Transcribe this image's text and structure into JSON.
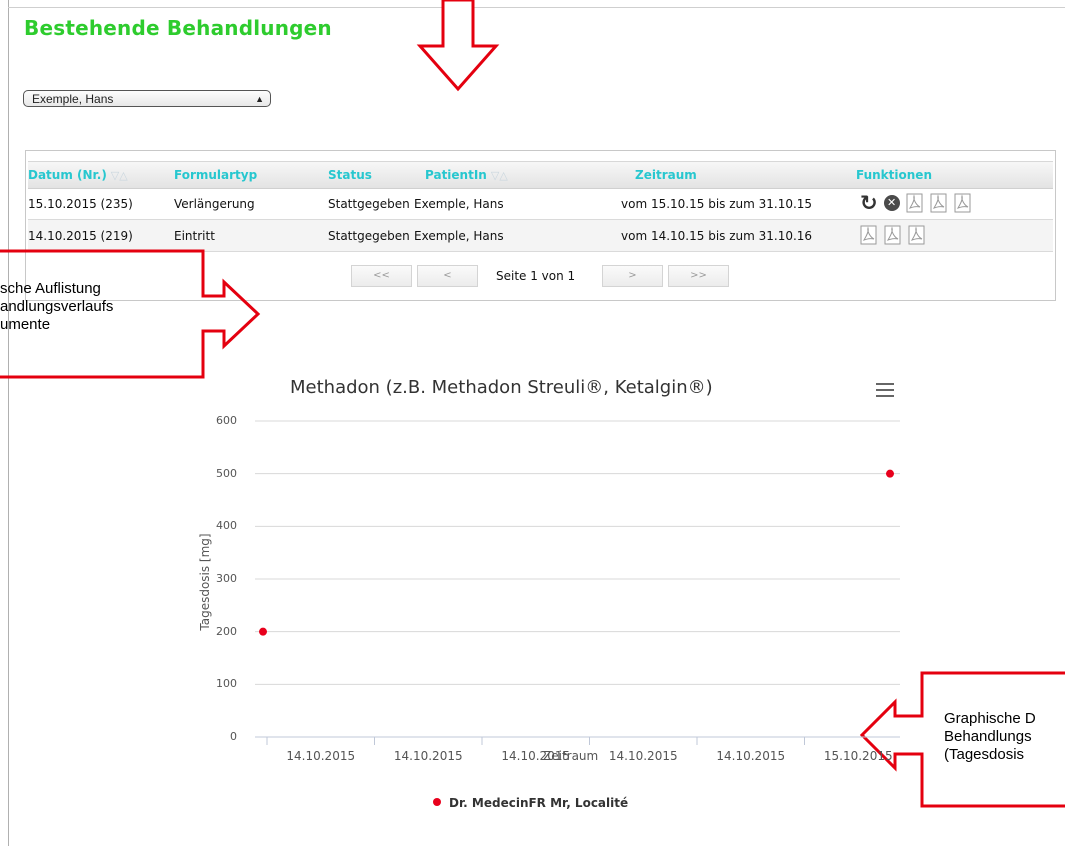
{
  "page_title": "Bestehende Behandlungen",
  "patient_select": {
    "value": "Exemple, Hans"
  },
  "table": {
    "headers": {
      "datum": "Datum (Nr.)",
      "formulartyp": "Formulartyp",
      "status": "Status",
      "patient": "PatientIn",
      "zeitraum": "Zeitraum",
      "funktionen": "Funktionen"
    },
    "sort_glyph": "▽△",
    "rows": [
      {
        "datum": "15.10.2015 (235)",
        "formulartyp": "Verlängerung",
        "status": "Stattgegeben",
        "patient": "Exemple, Hans",
        "zeitraum": "vom 15.10.15 bis zum 31.10.15"
      },
      {
        "datum": "14.10.2015 (219)",
        "formulartyp": "Eintritt",
        "status": "Stattgegeben",
        "patient": "Exemple, Hans",
        "zeitraum": "vom 14.10.15 bis zum 31.10.16"
      }
    ]
  },
  "pager": {
    "first": "<<",
    "prev": "<",
    "info": "Seite 1 von 1",
    "next": ">",
    "last": ">>"
  },
  "annotations": {
    "left_line1": "sche Auflistung",
    "left_line2": "andlungsverlaufs",
    "left_line3": "umente",
    "right_line1": "Graphische D",
    "right_line2": "Behandlungs",
    "right_line3": "(Tagesdosis"
  },
  "chart_data": {
    "type": "scatter",
    "title": "Methadon (z.B. Methadon Streuli®, Ketalgin®)",
    "xlabel": "Zeitraum",
    "ylabel": "Tagesdosis [mg]",
    "ylim": [
      0,
      600
    ],
    "y_ticks": [
      "0",
      "100",
      "200",
      "300",
      "400",
      "500",
      "600"
    ],
    "x_tick_labels": [
      "14.10.2015",
      "14.10.2015",
      "14.10.2015",
      "14.10.2015",
      "14.10.2015",
      "15.10.2015"
    ],
    "series": [
      {
        "name": "Dr. MedecinFR Mr, Localité",
        "color": "#e8001c",
        "x": [
          "14.10.2015",
          "15.10.2015"
        ],
        "y": [
          200,
          500
        ]
      }
    ],
    "grid": true,
    "legend_position": "bottom-center"
  }
}
